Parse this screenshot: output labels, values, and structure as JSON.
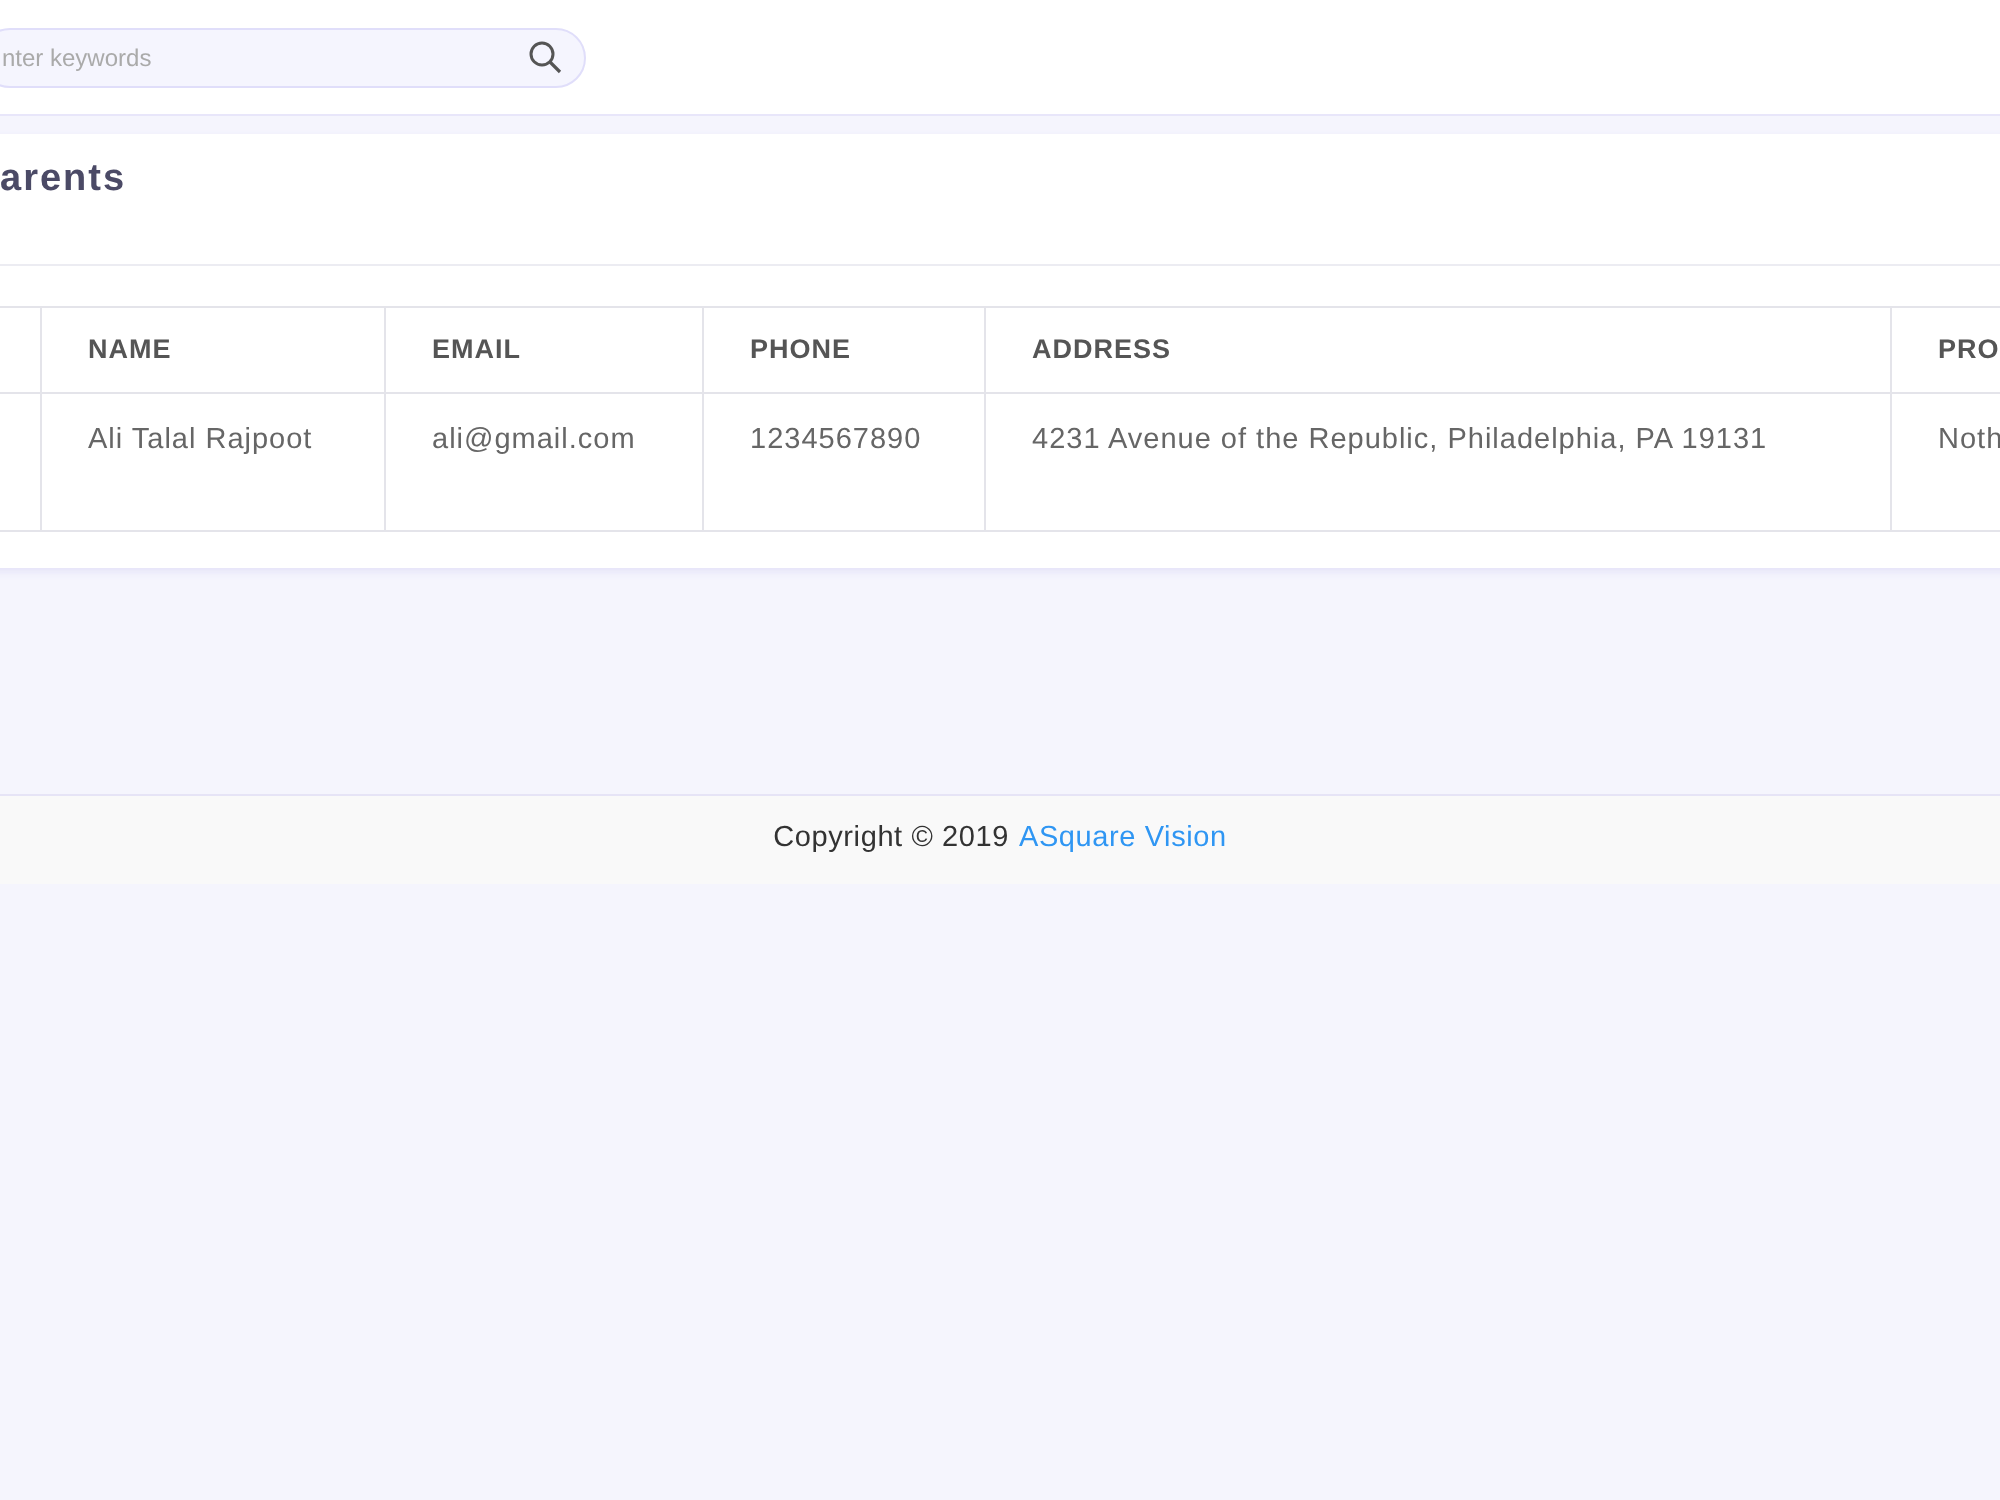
{
  "search": {
    "placeholder": "nter keywords"
  },
  "card": {
    "title": "arents",
    "table": {
      "columns": [
        "NAME",
        "EMAIL",
        "PHONE",
        "ADDRESS",
        "PRO"
      ],
      "rows": [
        [
          "Ali Talal Rajpoot",
          "ali@gmail.com",
          "1234567890",
          "4231 Avenue of the Republic, Philadelphia, PA 19131",
          "Noth"
        ]
      ]
    }
  },
  "footer": {
    "text": "Copyright © 2019",
    "link": "ASquare Vision"
  }
}
